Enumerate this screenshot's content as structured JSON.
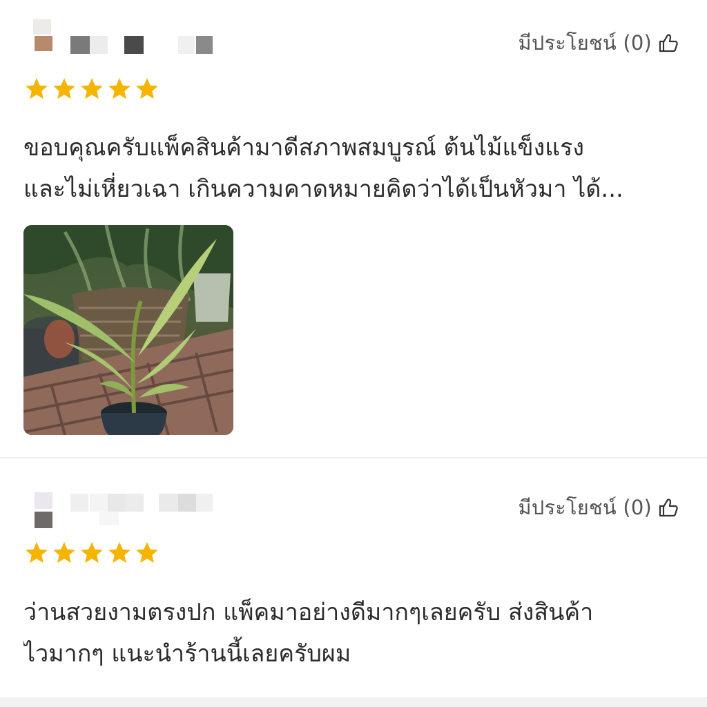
{
  "reviews": [
    {
      "reviewer_name": "",
      "rating": 5,
      "helpful_label": "มีประโยชน์ (0)",
      "helpful_icon": "thumbs-up-icon",
      "text_lines": [
        "ขอบคุณครับแพ็คสินค้ามาดีสภาพสมบูรณ์ ต้นไม้แข็งแรง",
        "และไม่เหี่ยวเฉา เกินความคาดหมายคิดว่าได้เป็นหัวมา ได้..."
      ],
      "has_photo": true
    },
    {
      "reviewer_name": "",
      "rating": 5,
      "helpful_label": "มีประโยชน์ (0)",
      "helpful_icon": "thumbs-up-icon",
      "text_lines": [
        "ว่านสวยงามตรงปก  แพ็คมาอย่างดีมากๆเลยครับ ส่งสินค้า",
        "ไวมากๆ  แนะนำร้านนี้เลยครับผม"
      ],
      "has_photo": false
    }
  ],
  "colors": {
    "star": "#f5b400",
    "text": "#2b2b2b",
    "helpful_text": "#555555",
    "divider": "#eeeeee"
  }
}
